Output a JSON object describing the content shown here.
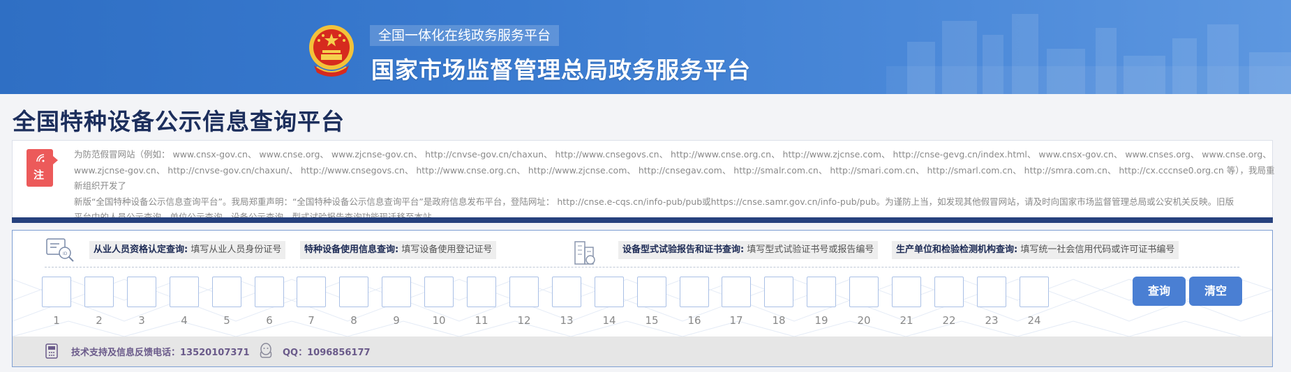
{
  "banner": {
    "subtitle": "全国一体化在线政务服务平台",
    "title": "国家市场监督管理总局政务服务平台"
  },
  "page": {
    "title": "全国特种设备公示信息查询平台"
  },
  "notice": {
    "badge": "注",
    "lines": [
      "为防范假冒网站（例如： www.cnsx-gov.cn、 www.cnse.org、 www.zjcnse-gov.cn、 http://cnvse-gov.cn/chaxun、 http://www.cnsegovs.cn、 http://www.cnse.org.cn、 http://www.zjcnse.com、 http://cnse-gevg.cn/index.html、 www.cnsx-gov.cn、 www.cnses.org、 www.cnse.org、",
      "www.zjcnse-gov.cn、 http://cnvse-gov.cn/chaxun/、 http://www.cnsegovs.cn、 http://www.cnse.org.cn、 http://www.zjcnse.com、 http://cnsegav.com、 http://smalr.com.cn、 http://smari.com.cn、 http://smarl.com.cn、 http://smra.com.cn、 http://cx.cccnse0.org.cn 等），我局重新组织开发了",
      "新版“全国特种设备公示信息查询平台”。我局郑重声明：“全国特种设备公示信息查询平台”是政府信息发布平台，登陆网址： http://cnse.e-cqs.cn/info-pub/pub或https://cnse.samr.gov.cn/info-pub/pub。为谨防上当，如发现其他假冒网站，请及时向国家市场监督管理总局或公安机关反映。旧版",
      "平台中的人员公示查询、单位公示查询、设备公示查询、型式试验报告查询功能现迁移至本站。"
    ]
  },
  "query_types": [
    {
      "label": "从业人员资格认定查询:",
      "hint": "填写从业人员身份证号"
    },
    {
      "label": "特种设备使用信息查询:",
      "hint": "填写设备使用登记证号"
    },
    {
      "label": "设备型式试验报告和证书查询:",
      "hint": "填写型式试验证书号或报告编号"
    },
    {
      "label": "生产单位和检验检测机构查询:",
      "hint": "填写统一社会信用代码或许可证书编号"
    }
  ],
  "char_boxes": [
    "1",
    "2",
    "3",
    "4",
    "5",
    "6",
    "7",
    "8",
    "9",
    "10",
    "11",
    "12",
    "13",
    "14",
    "15",
    "16",
    "17",
    "18",
    "19",
    "20",
    "21",
    "22",
    "23",
    "24"
  ],
  "buttons": {
    "query": "查询",
    "clear": "清空"
  },
  "footer": {
    "support": "技术支持及信息反馈电话：13520107371",
    "qq": "QQ：1096856177"
  },
  "colors": {
    "banner": "#3a7bd0",
    "title": "#1c2e5c",
    "notice_badge": "#ec5a5a",
    "notice_bar": "#26417d",
    "button": "#4a7fd3",
    "input_border": "#aac0e6"
  },
  "icons": {
    "emblem": "national-emblem-icon",
    "notice": "signal-icon",
    "id_card": "id-card-search-icon",
    "building": "building-icon",
    "phone": "phone-icon",
    "qq": "qq-penguin-icon"
  }
}
